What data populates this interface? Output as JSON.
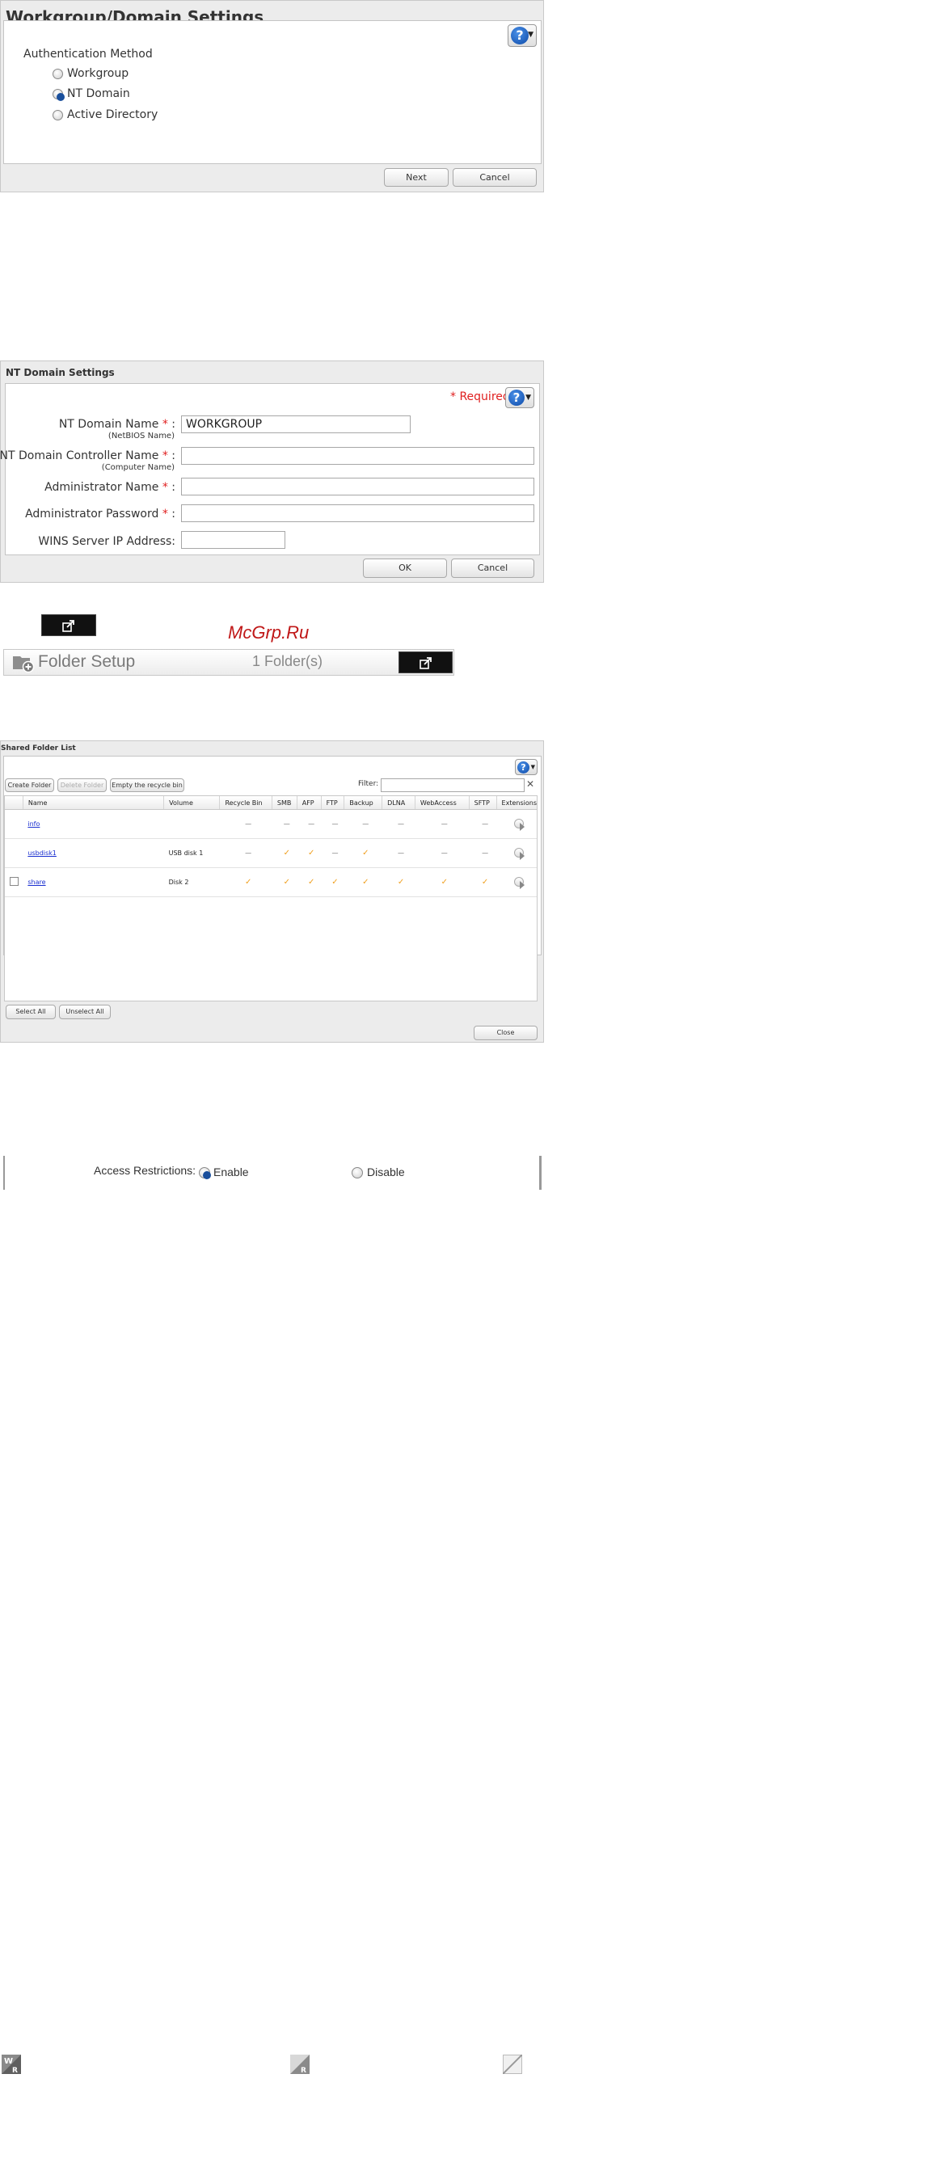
{
  "workgroup_dialog": {
    "title": "Workgroup/Domain Settings",
    "auth_label": "Authentication Method",
    "options": [
      "Workgroup",
      "NT Domain",
      "Active Directory"
    ],
    "selected": "NT Domain",
    "next_label": "Next",
    "cancel_label": "Cancel"
  },
  "nt_dialog": {
    "title": "NT Domain Settings",
    "required_note": "Required",
    "fields": {
      "domain_name": {
        "label": "NT Domain Name",
        "sub": "(NetBIOS Name)",
        "value": "WORKGROUP"
      },
      "controller_name": {
        "label": "NT Domain Controller Name",
        "sub": "(Computer Name)",
        "value": ""
      },
      "admin_name": {
        "label": "Administrator Name",
        "value": ""
      },
      "admin_password": {
        "label": "Administrator Password",
        "value": ""
      },
      "wins": {
        "label": "WINS Server IP Address:",
        "value": ""
      }
    },
    "ok_label": "OK",
    "cancel_label": "Cancel"
  },
  "watermark": "McGrp.Ru",
  "folder_setup": {
    "title": "Folder Setup",
    "count": "1 Folder(s)"
  },
  "shared_list": {
    "title": "Shared Folder List",
    "create_label": "Create Folder",
    "delete_label": "Delete Folder",
    "empty_label": "Empty the recycle bin",
    "filter_label": "Filter:",
    "columns": [
      "Name",
      "Volume",
      "Recycle Bin",
      "SMB",
      "AFP",
      "FTP",
      "Backup",
      "DLNA",
      "WebAccess",
      "SFTP",
      "Extensions"
    ],
    "rows": [
      {
        "name": "info",
        "volume": "",
        "cells": [
          "—",
          "—",
          "—",
          "—",
          "—",
          "—",
          "—",
          "—"
        ]
      },
      {
        "name": "usbdisk1",
        "volume": "USB disk 1",
        "cells": [
          "—",
          "✓",
          "✓",
          "—",
          "✓",
          "—",
          "—",
          "—"
        ]
      },
      {
        "name": "share",
        "volume": "Disk 2",
        "cells": [
          "✓",
          "✓",
          "✓",
          "✓",
          "✓",
          "✓",
          "✓",
          "✓"
        ]
      }
    ],
    "select_all": "Select All",
    "unselect_all": "Unselect All",
    "close_label": "Close"
  },
  "access": {
    "label": "Access Restrictions:",
    "enable": "Enable",
    "disable": "Disable",
    "selected": "Enable"
  },
  "perm_icons": [
    "W R",
    "R",
    ""
  ]
}
